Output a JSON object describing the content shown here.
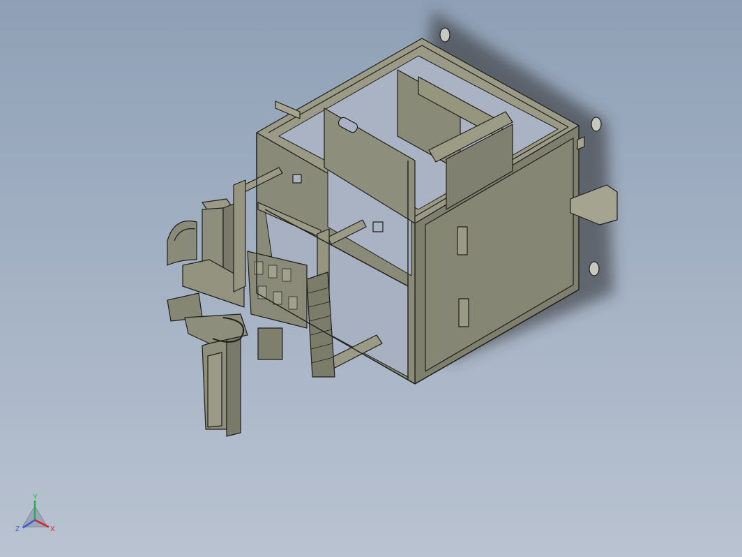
{
  "viewport": {
    "background_top": "#8fa0b6",
    "background_bottom": "#b9c3d1",
    "model_color": "#8e8e7c",
    "edge_color": "#1e1e1a"
  },
  "triad": {
    "x_label": "X",
    "y_label": "Y",
    "z_label": "Z",
    "x_color": "#d8202a",
    "y_color": "#22b14c",
    "z_color": "#2c5cd8"
  }
}
